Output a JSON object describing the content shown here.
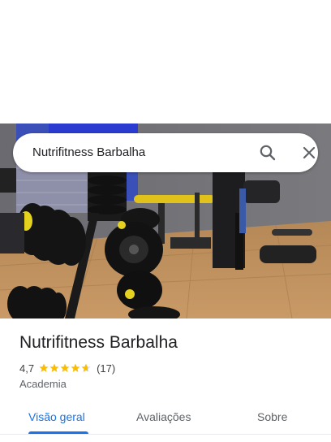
{
  "search": {
    "query": "Nutrifitness Barbalha"
  },
  "place": {
    "name": "Nutrifitness Barbalha",
    "rating": "4,7",
    "review_count": "(17)",
    "stars": 4.7,
    "category": "Academia"
  },
  "tabs": [
    {
      "label": "Visão geral",
      "active": true
    },
    {
      "label": "Avaliações",
      "active": false
    },
    {
      "label": "Sobre",
      "active": false
    }
  ],
  "colors": {
    "accent": "#1a73e8",
    "star": "#fbbc04"
  },
  "icons": {
    "search": "search-icon",
    "close": "close-icon"
  }
}
